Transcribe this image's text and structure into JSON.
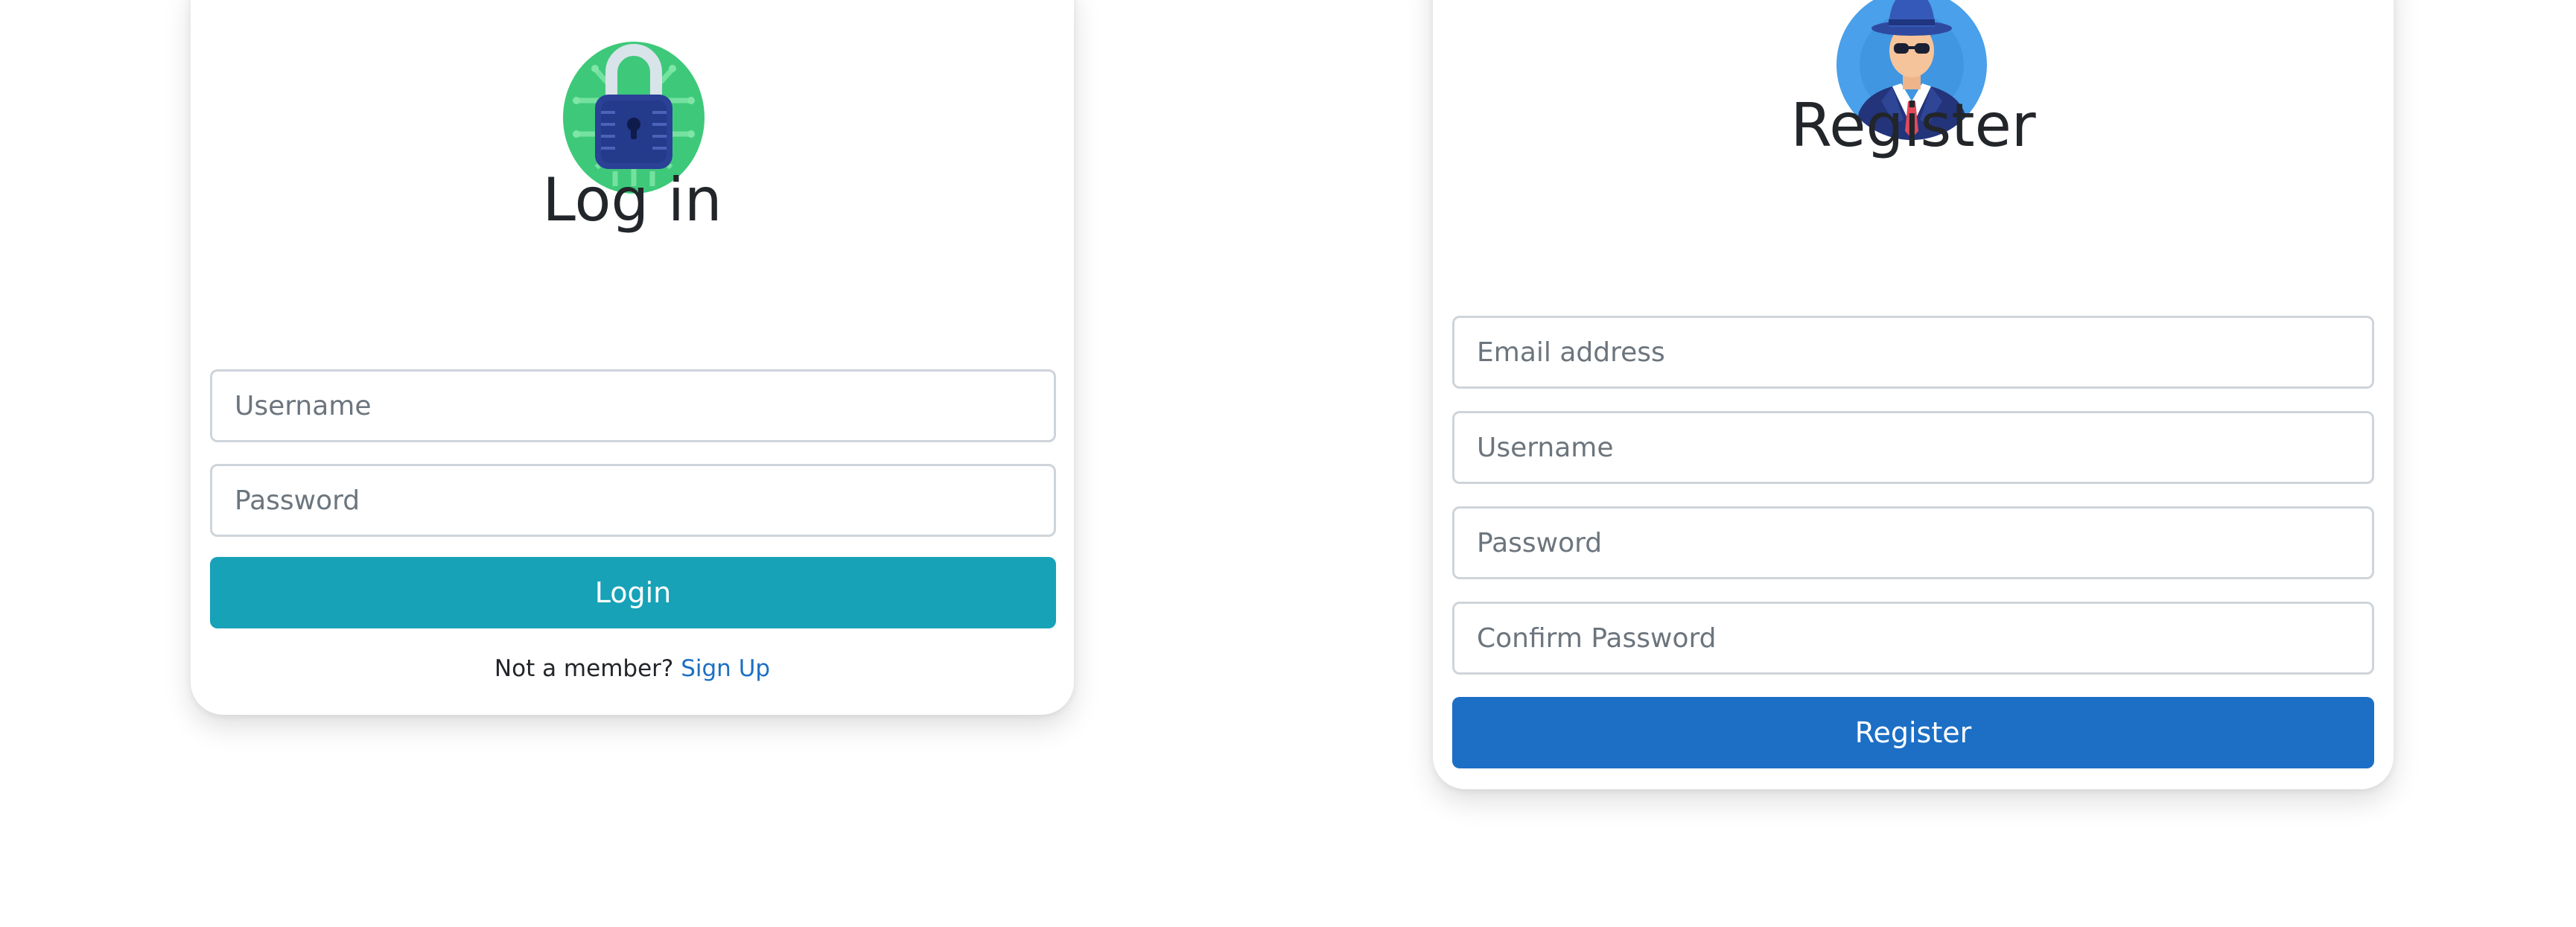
{
  "login": {
    "icon": "padlock-icon",
    "title": "Log in",
    "username_placeholder": "Username",
    "password_placeholder": "Password",
    "button_label": "Login",
    "footer_text": "Not a member?",
    "signup_link": "Sign Up",
    "colors": {
      "button": "#17a2b8",
      "icon_background": "#3ec97a"
    }
  },
  "register": {
    "icon": "spy-avatar-icon",
    "title": "Register",
    "email_placeholder": "Email address",
    "username_placeholder": "Username",
    "password_placeholder": "Password",
    "confirm_password_placeholder": "Confirm Password",
    "button_label": "Register",
    "colors": {
      "button": "#1c6fc4",
      "icon_background": "#4aa0ea"
    }
  }
}
